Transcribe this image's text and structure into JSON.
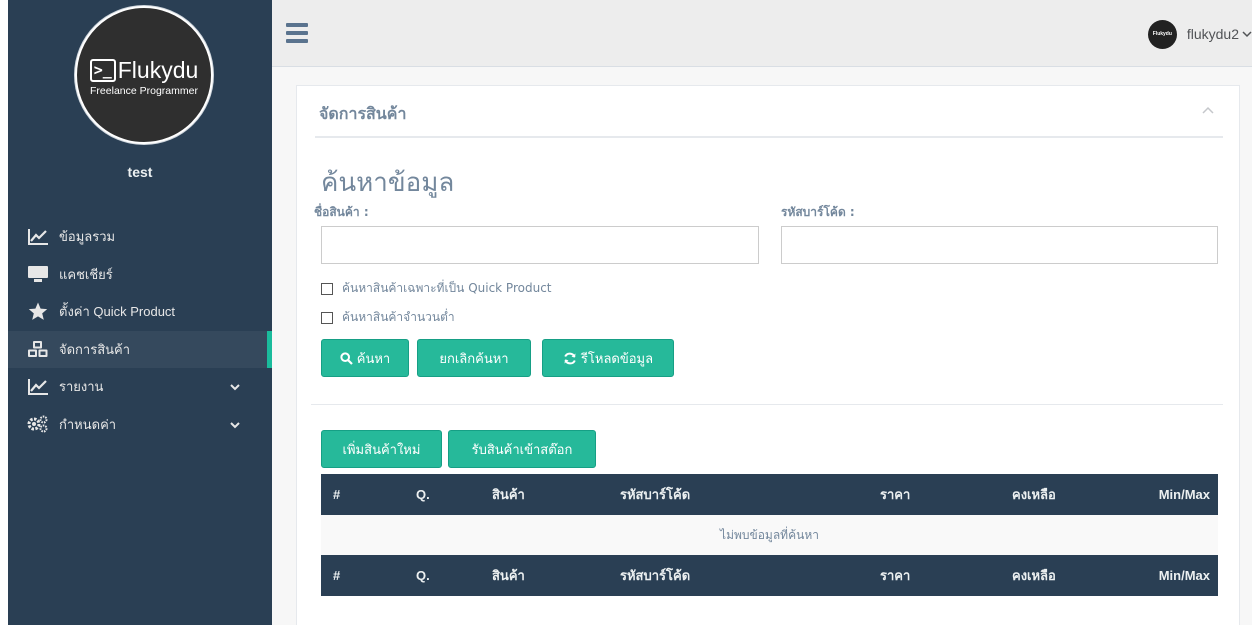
{
  "brand": {
    "logo_prompt": ">_",
    "logo_name": "Flukydu",
    "logo_tagline": "Freelance Programmer"
  },
  "profile": {
    "name": "test"
  },
  "sidebar": {
    "items": [
      {
        "label": "ข้อมูลรวม",
        "icon": "line-chart-icon"
      },
      {
        "label": "แคชเชียร์",
        "icon": "monitor-icon"
      },
      {
        "label": "ตั้งค่า Quick Product",
        "icon": "star-icon"
      },
      {
        "label": "จัดการสินค้า",
        "icon": "cubes-icon",
        "active": true
      },
      {
        "label": "รายงาน",
        "icon": "line-chart-icon",
        "has_submenu": true
      },
      {
        "label": "กำหนดค่า",
        "icon": "gears-icon",
        "has_submenu": true
      }
    ]
  },
  "topbar": {
    "user_name": "flukydu2",
    "avatar_text": "Flukydu"
  },
  "panel": {
    "title": "จัดการสินค้า",
    "search": {
      "heading": "ค้นหาข้อมูล",
      "product_name_label": "ชื่อสินค้า :",
      "product_name_value": "",
      "barcode_label": "รหัสบาร์โค้ด :",
      "barcode_value": "",
      "quick_product_checkbox": "ค้นหาสินค้าเฉพาะที่เป็น Quick Product",
      "low_stock_checkbox": "ค้นหาสินค้าจำนวนต่ำ",
      "search_button": "ค้นหา",
      "cancel_button": "ยกเลิกค้นหา",
      "reload_button": "รีโหลดข้อมูล"
    },
    "actions": {
      "add_product_button": "เพิ่มสินค้าใหม่",
      "receive_stock_button": "รับสินค้าเข้าสต๊อก"
    },
    "table": {
      "columns": [
        "#",
        "Q.",
        "สินค้า",
        "รหัสบาร์โค้ด",
        "ราคา",
        "คงเหลือ",
        "Min/Max"
      ],
      "empty_message": "ไม่พบข้อมูลที่ค้นหา"
    }
  },
  "colors": {
    "sidebar_bg": "#2A3F54",
    "accent_green": "#26B99A",
    "active_marker": "#1ABB9C",
    "table_header_bg": "#2A3F54"
  }
}
